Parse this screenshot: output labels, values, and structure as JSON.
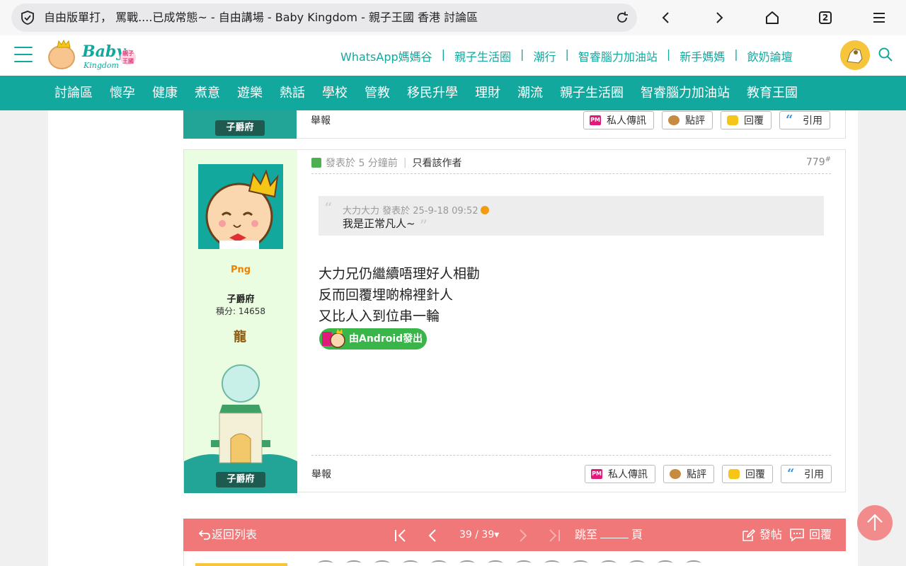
{
  "browser": {
    "url_title": "自由版單打， 罵戰....已成常態~ - 自由講場 - Baby Kingdom - 親子王國 香港 討論區",
    "tab_count": "2"
  },
  "header": {
    "logo_text": "Baby",
    "logo_sub": "Kingdom",
    "logo_badge": "親子王國",
    "top_links": [
      "WhatsApp媽媽谷",
      "親子生活圈",
      "潮行",
      "智睿腦力加油站",
      "新手媽媽",
      "飲奶論壇"
    ],
    "separator": "|"
  },
  "nav": {
    "items": [
      "討論區",
      "懷孕",
      "健康",
      "煮意",
      "遊樂",
      "熱話",
      "學校",
      "管教",
      "移民升學",
      "理財",
      "潮流",
      "親子生活圈",
      "智睿腦力加油站",
      "教育王國"
    ]
  },
  "prev_post": {
    "report": "舉報",
    "rank_plaque": "子爵府"
  },
  "post": {
    "username": "Png",
    "rank": "子爵府",
    "credits": "積分: 14658",
    "medal": "龍",
    "rank_plaque": "子爵府",
    "posted_at": "發表於 5 分鐘前",
    "author_only": "只看該作者",
    "floor": "779",
    "floor_mark": "#",
    "quote": {
      "header": "大力大力 發表於 25-9-18 09:52",
      "text": "我是正常凡人~",
      "open": "“",
      "close": "”"
    },
    "body_lines": [
      "大力兄仍繼續唔理好人相勸",
      "反而回覆埋啲棉裡針人",
      "又比人入到位串一輪"
    ],
    "android_badge": "由Android發出",
    "report": "舉報"
  },
  "actions": {
    "pm": "私人傳訊",
    "rate": "點評",
    "reply": "回覆",
    "quote": "引用",
    "pm_icon_text": "PM"
  },
  "pager": {
    "back": "返回列表",
    "page": "39 / 39",
    "page_caret": "▾",
    "jump_prefix": "跳至",
    "jump_suffix": "頁",
    "new_post": "發帖",
    "reply": "回覆"
  },
  "colors": {
    "teal": "#13a89e",
    "pager": "#f07878",
    "sidebar": "#eafde0"
  }
}
